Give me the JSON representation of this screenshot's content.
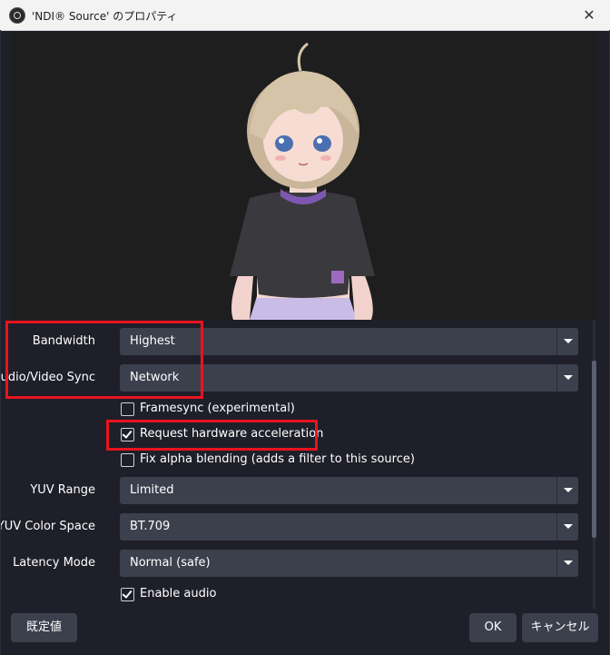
{
  "window": {
    "title": "'NDI® Source' のプロパティ",
    "close_glyph": "✕"
  },
  "settings": {
    "bandwidth": {
      "label": "Bandwidth",
      "value": "Highest"
    },
    "av_sync": {
      "label": "Audio/Video Sync",
      "value": "Network"
    },
    "framesync": {
      "label": "Framesync (experimental)",
      "checked": false
    },
    "hw_accel": {
      "label": "Request hardware acceleration",
      "checked": true
    },
    "fix_alpha": {
      "label": "Fix alpha blending (adds a filter to this source)",
      "checked": false
    },
    "yuv_range": {
      "label": "YUV Range",
      "value": "Limited"
    },
    "yuv_color_space": {
      "label": "YUV Color Space",
      "value": "BT.709"
    },
    "latency_mode": {
      "label": "Latency Mode",
      "value": "Normal (safe)"
    },
    "enable_audio": {
      "label": "Enable audio",
      "checked": true
    }
  },
  "buttons": {
    "defaults": "既定値",
    "ok": "OK",
    "cancel": "キャンセル"
  },
  "colors": {
    "background": "#1e1f29",
    "control": "#3c404d",
    "highlight": "#e8141e"
  }
}
